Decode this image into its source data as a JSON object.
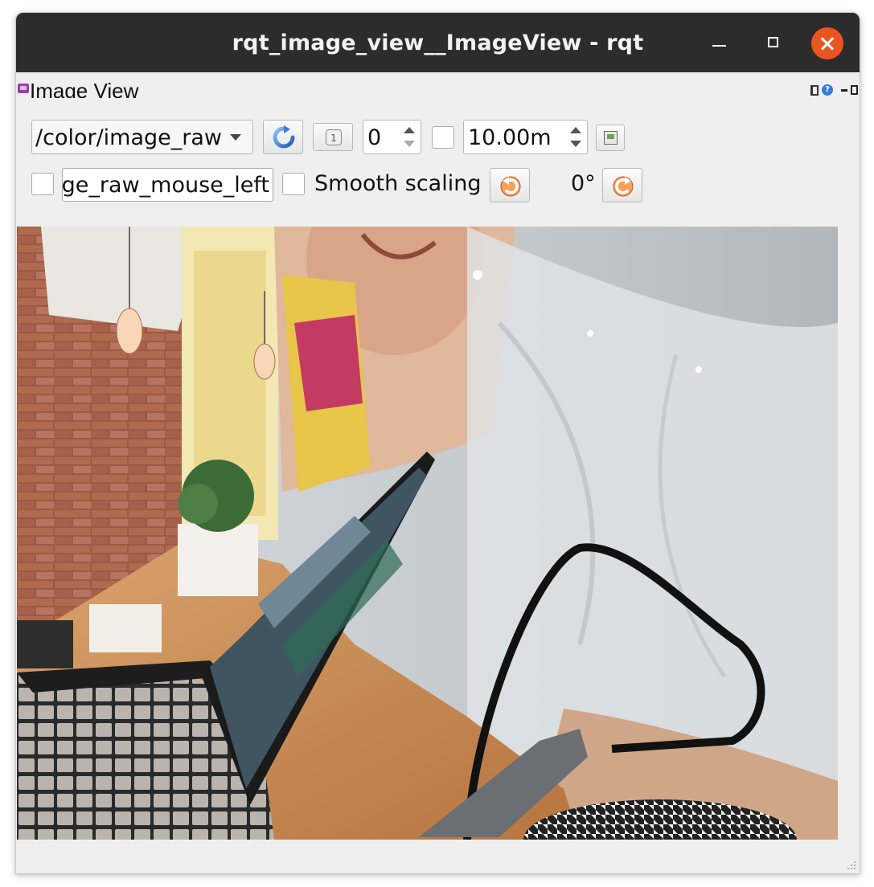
{
  "window": {
    "title": "rqt_image_view__ImageView - rqt"
  },
  "dock": {
    "title": "Image View",
    "help_label": "?"
  },
  "toolbar": {
    "topic_value": "/color/image_raw",
    "small_button_label": "1",
    "spin_value": "0",
    "duration_value": "10.00m",
    "mouse_topic_value": "ge_raw_mouse_left",
    "smooth_label": "Smooth scaling",
    "rotation_label": "0°"
  },
  "colors": {
    "titlebar": "#2c2c2c",
    "close_button": "#e95420",
    "background": "#efefef",
    "rotate_icon": "#e0641e",
    "refresh_icon": "#3a7bd5"
  },
  "icons": {
    "refresh": "refresh-icon",
    "rotate_left": "rotate-left-icon",
    "rotate_right": "rotate-right-icon",
    "save": "save-icon",
    "help": "help-icon"
  }
}
